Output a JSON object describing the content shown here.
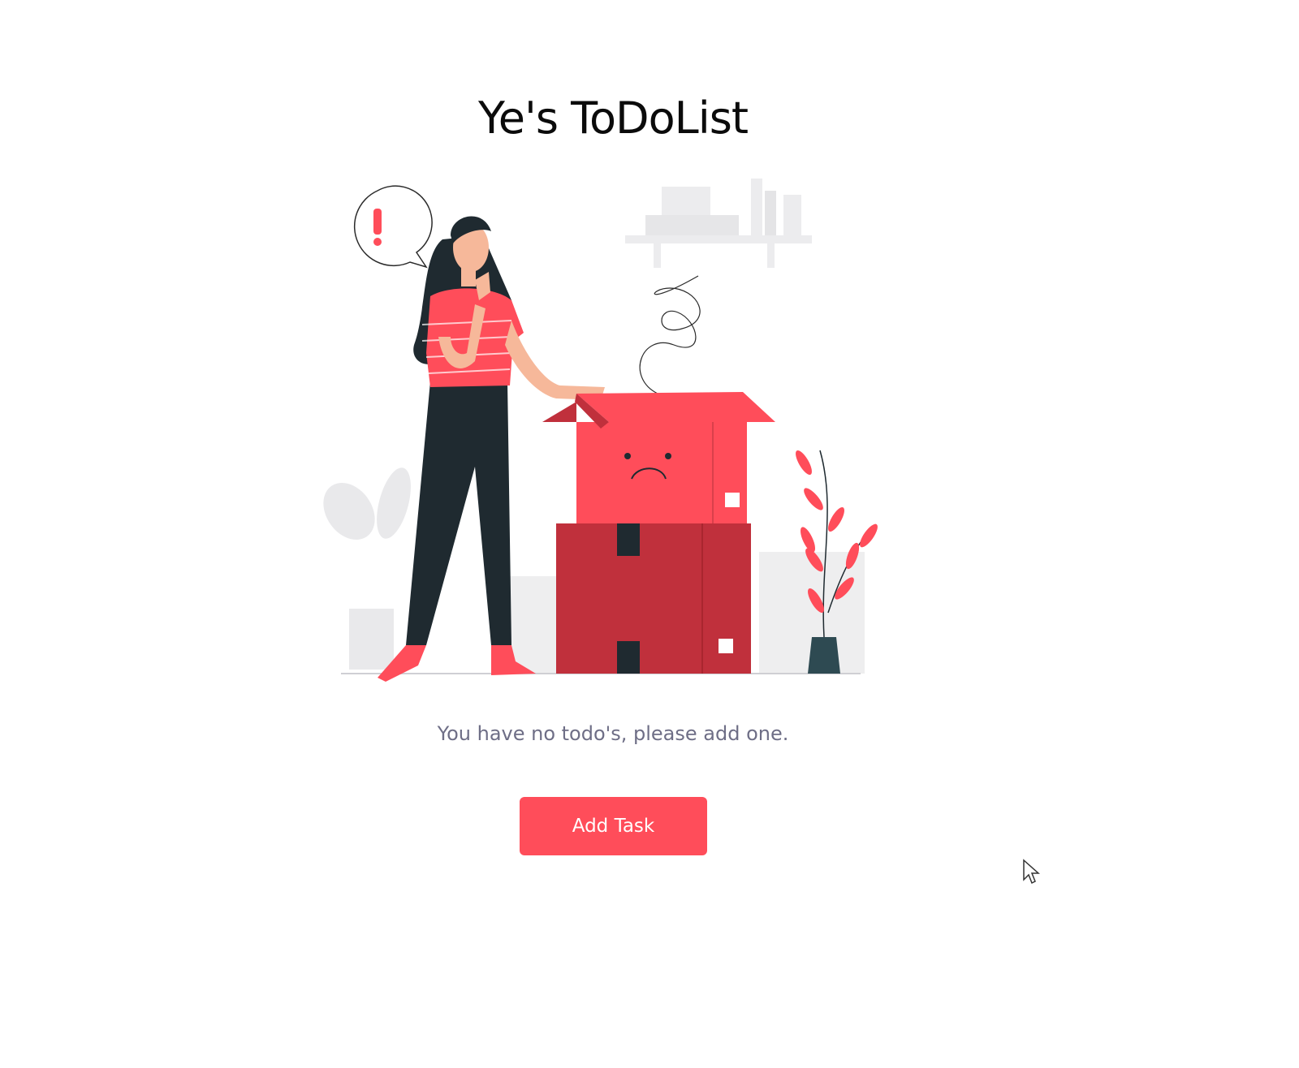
{
  "header": {
    "title": "Ye's ToDoList"
  },
  "empty_state": {
    "illustration_icon": "empty-box-illustration",
    "alert_symbol": "!",
    "message": "You have no todo's, please add one."
  },
  "actions": {
    "add_task_label": "Add Task"
  },
  "colors": {
    "accent": "#ff4d5a",
    "accent_dark": "#c0303c",
    "dark": "#1f2a30",
    "text_muted": "#6e6e86",
    "skin": "#f6b89a",
    "light_gray": "#ececee"
  }
}
